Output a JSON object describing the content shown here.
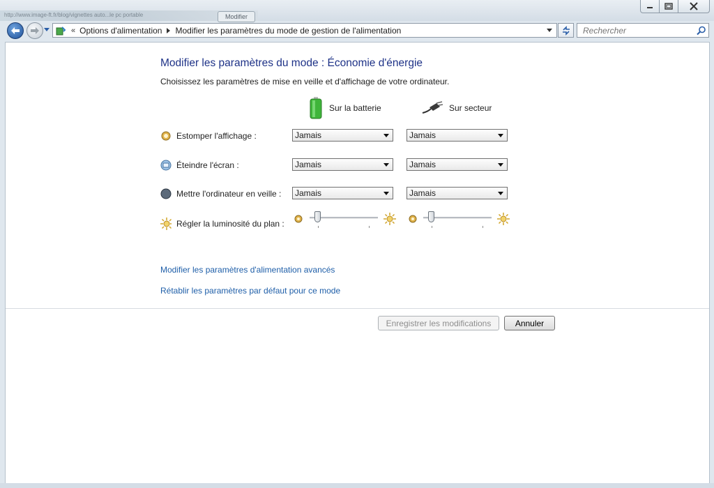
{
  "window": {
    "background_strip_text": "http://www.image-ft.fr/blog/vignettes auto...le pc portable",
    "background_strip_button": "Modifier"
  },
  "address": {
    "overflow": "«",
    "crumbs": [
      "Options d'alimentation",
      "Modifier les paramètres du mode de gestion de l'alimentation"
    ]
  },
  "search": {
    "placeholder": "Rechercher"
  },
  "page": {
    "title": "Modifier les paramètres du mode : Économie d'énergie",
    "subtitle": "Choisissez les paramètres de mise en veille et d'affichage de votre ordinateur.",
    "columns": {
      "battery": "Sur la batterie",
      "ac": "Sur secteur"
    },
    "rows": [
      {
        "label": "Estomper l'affichage :",
        "battery": "Jamais",
        "ac": "Jamais",
        "icon": "dim-display-icon"
      },
      {
        "label": "Éteindre l'écran :",
        "battery": "Jamais",
        "ac": "Jamais",
        "icon": "monitor-icon"
      },
      {
        "label": "Mettre l'ordinateur en veille :",
        "battery": "Jamais",
        "ac": "Jamais",
        "icon": "moon-sleep-icon"
      }
    ],
    "brightness": {
      "label": "Régler la luminosité du plan :",
      "battery_level": 0.08,
      "ac_level": 0.08
    },
    "links": {
      "advanced": "Modifier les paramètres d'alimentation avancés",
      "restore": "Rétablir les paramètres par défaut pour ce mode"
    },
    "buttons": {
      "save": "Enregistrer les modifications",
      "cancel": "Annuler"
    }
  },
  "colors": {
    "heading": "#1e3287",
    "link": "#1e5ea8",
    "battery": "#3fb53a"
  }
}
